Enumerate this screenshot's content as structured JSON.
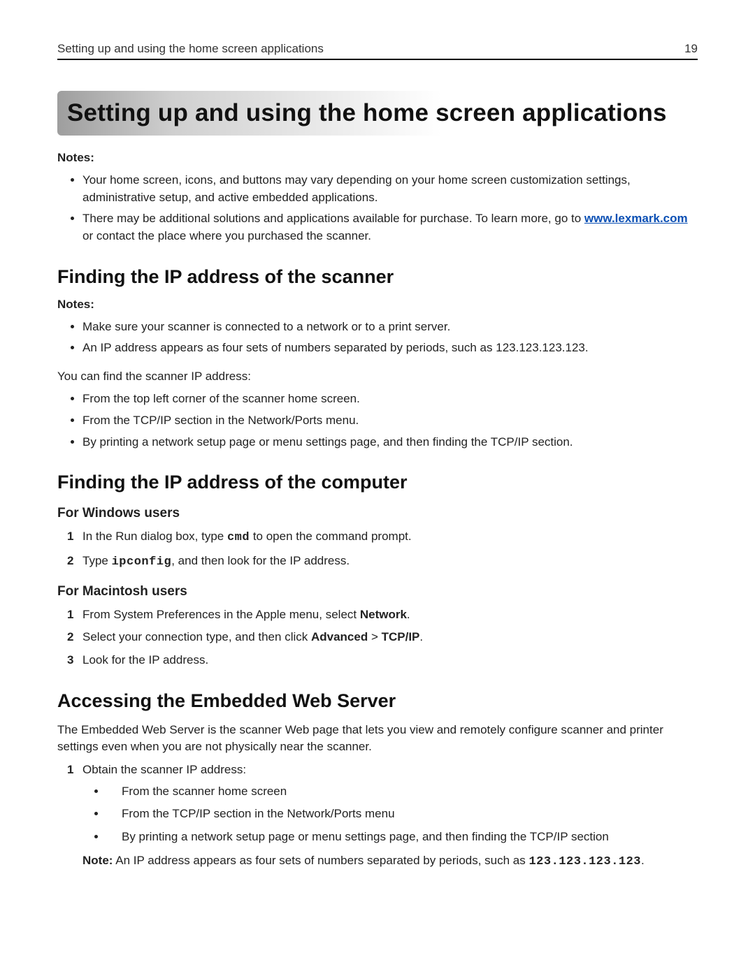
{
  "header": {
    "running_title": "Setting up and using the home screen applications",
    "page_number": "19"
  },
  "title": "Setting up and using the home screen applications",
  "intro": {
    "notes_label": "Notes:",
    "bullets": [
      {
        "text": "Your home screen, icons, and buttons may vary depending on your home screen customization settings, administrative setup, and active embedded applications."
      },
      {
        "pre": "There may be additional solutions and applications available for purchase. To learn more, go to ",
        "link_text": "www.lexmark.com",
        "post": " or contact the place where you purchased the scanner."
      }
    ]
  },
  "sec_ip_scanner": {
    "heading": "Finding the IP address of the scanner",
    "notes_label": "Notes:",
    "notes_bullets": [
      "Make sure your scanner is connected to a network or to a print server.",
      "An IP address appears as four sets of numbers separated by periods, such as 123.123.123.123."
    ],
    "lead": "You can find the scanner IP address:",
    "bullets": [
      "From the top left corner of the scanner home screen.",
      "From the TCP/IP section in the Network/Ports menu.",
      "By printing a network setup page or menu settings page, and then finding the TCP/IP section."
    ]
  },
  "sec_ip_computer": {
    "heading": "Finding the IP address of the computer",
    "windows": {
      "heading": "For Windows users",
      "steps": [
        {
          "num": "1",
          "pre": "In the Run dialog box, type ",
          "mono": "cmd",
          "post": " to open the command prompt."
        },
        {
          "num": "2",
          "pre": "Type ",
          "mono": "ipconfig",
          "post": ", and then look for the IP address."
        }
      ]
    },
    "mac": {
      "heading": "For Macintosh users",
      "steps": [
        {
          "num": "1",
          "pre": "From System Preferences in the Apple menu, select ",
          "bold": "Network",
          "post": "."
        },
        {
          "num": "2",
          "pre": "Select your connection type, and then click ",
          "bold": "Advanced",
          "mid": " > ",
          "bold2": "TCP/IP",
          "post": "."
        },
        {
          "num": "3",
          "pre": "Look for the IP address."
        }
      ]
    }
  },
  "sec_ews": {
    "heading": "Accessing the Embedded Web Server",
    "intro": "The Embedded Web Server is the scanner Web page that lets you view and remotely configure scanner and printer settings even when you are not physically near the scanner.",
    "step1": {
      "num": "1",
      "text": "Obtain the scanner IP address:"
    },
    "sub_bullets": [
      "From the scanner home screen",
      "From the TCP/IP section in the Network/Ports menu",
      "By printing a network setup page or menu settings page, and then finding the TCP/IP section"
    ],
    "note": {
      "label": "Note:",
      "pre": " An IP address appears as four sets of numbers separated by periods, such as ",
      "mono": "123.123.123.123",
      "post": "."
    }
  }
}
